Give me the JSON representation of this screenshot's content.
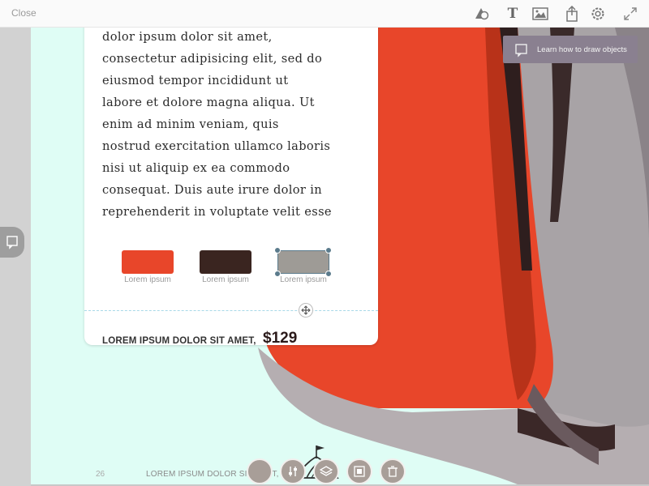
{
  "topbar": {
    "close_label": "Close",
    "tools": [
      "shapes-icon",
      "text-icon",
      "image-icon",
      "share-icon",
      "settings-icon",
      "fullscreen-icon"
    ],
    "text_tool_glyph": "T"
  },
  "tooltip": {
    "text": "Learn how to draw objects"
  },
  "card": {
    "body_lines": [
      "dolor ipsum dolor sit amet,",
      "consectetur adipisicing elit, sed do",
      "eiusmod tempor incididunt ut",
      "labore et dolore magna aliqua. Ut",
      "enim ad minim veniam, quis",
      "nostrud exercitation ullamco laboris",
      "nisi ut aliquip ex ea commodo",
      "consequat. Duis aute irure dolor in",
      "reprehenderit in voluptate velit esse"
    ],
    "swatches": [
      {
        "color": "#e8462a",
        "label": "Lorem ipsum"
      },
      {
        "color": "#3a2520",
        "label": "Lorem ipsum"
      },
      {
        "color": "#9e9b96",
        "label": "Lorem ipsum"
      }
    ],
    "price_label": "LOREM IPSUM DOLOR SIT AMET,",
    "price": "$129"
  },
  "footer": {
    "page_number": "26",
    "text": "LOREM IPSUM DOLOR SIT AMET,"
  },
  "bottom_tools": [
    "color-icon",
    "adjust-icon",
    "layers-icon",
    "arrange-icon",
    "delete-icon"
  ],
  "colors": {
    "canvas_bg": "#dffdf5",
    "bag_orange": "#e8462a",
    "bag_grey": "#a8a3a6",
    "tooltip_bg": "#8a8090"
  }
}
